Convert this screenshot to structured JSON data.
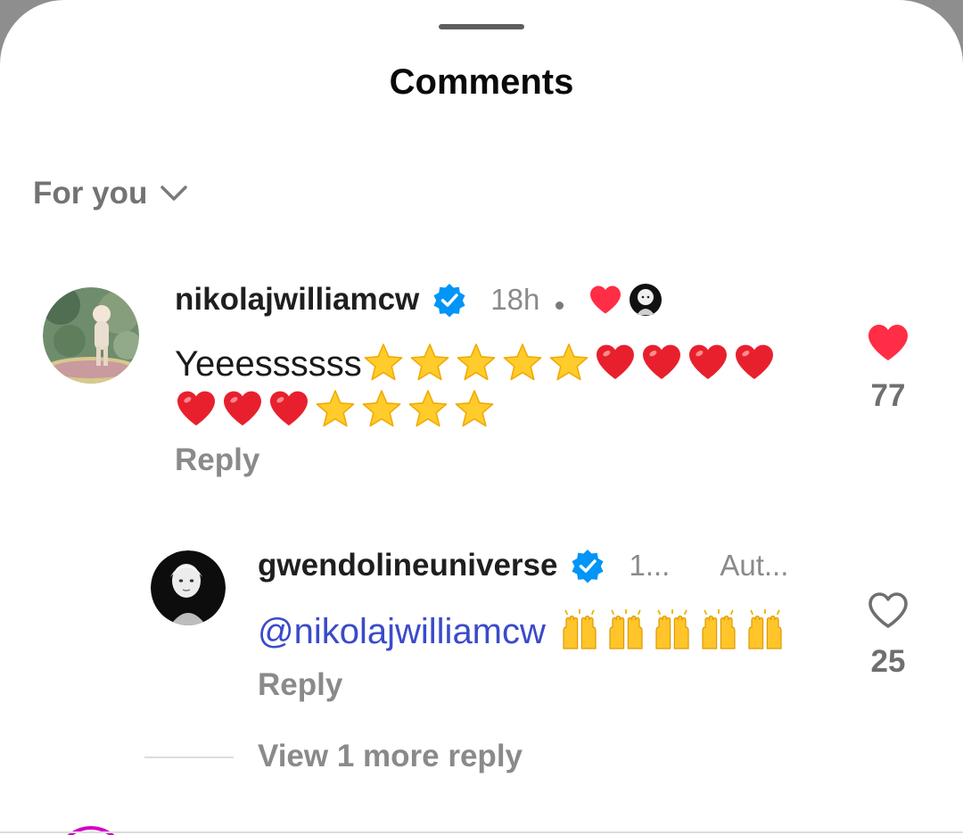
{
  "sheet": {
    "title": "Comments"
  },
  "sort": {
    "label": "For you"
  },
  "comments": [
    {
      "username": "nikolajwilliamcw",
      "verified": true,
      "time": "18h",
      "text": "Yeeessssss",
      "emoji_line1": [
        "star",
        "star",
        "star",
        "star",
        "star",
        "heart",
        "heart",
        "heart",
        "heart"
      ],
      "emoji_line2": [
        "heart",
        "heart",
        "heart",
        "star",
        "star",
        "star",
        "star"
      ],
      "reply_label": "Reply",
      "like_count": "77",
      "liked": true
    },
    {
      "username": "gwendolineuniverse",
      "verified": true,
      "time": "1...",
      "tag": "Aut...",
      "mention": "@nikolajwilliamcw",
      "emoji": [
        "raised-hands",
        "raised-hands",
        "raised-hands",
        "raised-hands",
        "raised-hands"
      ],
      "reply_label": "Reply",
      "like_count": "25",
      "liked": false
    }
  ],
  "thread": {
    "view_more_label": "View 1 more reply"
  },
  "colors": {
    "like_red": "#ff2d45",
    "verified_blue": "#0095f6",
    "mention": "#3a4bc9"
  }
}
